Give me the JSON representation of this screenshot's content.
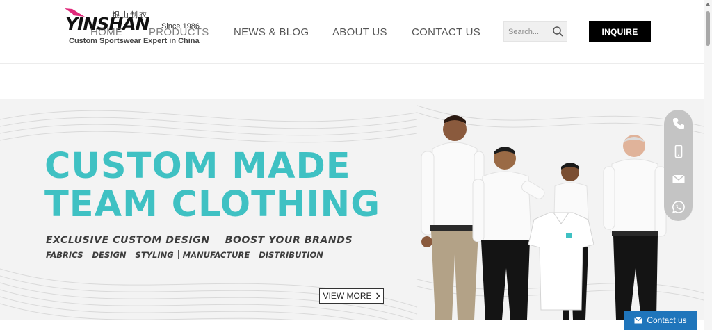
{
  "brand": {
    "name": "YINSHAN",
    "chinese": "银山制衣",
    "since": "Since 1986",
    "tagline": "Custom Sportswear Expert in China",
    "accent_color": "#e0287a"
  },
  "nav": {
    "items": [
      {
        "label": "HOME"
      },
      {
        "label": "PRODUCTS"
      },
      {
        "label": "NEWS & BLOG"
      },
      {
        "label": "ABOUT US"
      },
      {
        "label": "CONTACT US"
      }
    ]
  },
  "search": {
    "placeholder": "Search...",
    "icon": "search-icon"
  },
  "inquire": {
    "label": "INQUIRE"
  },
  "banner": {
    "headline_1": "CUSTOM MADE",
    "headline_2": "TEAM CLOTHING",
    "subline_1": "EXCLUSIVE CUSTOM DESIGN",
    "subline_2": "BOOST YOUR BRANDS",
    "services": [
      "FABRICS",
      "DESIGN",
      "STYLING",
      "MANUFACTURE",
      "DISTRIBUTION"
    ],
    "view_more": "VIEW MORE",
    "headline_color": "#3fc1c3"
  },
  "contact_rail": {
    "icons": [
      "phone-icon",
      "mobile-icon",
      "email-icon",
      "whatsapp-icon"
    ]
  },
  "contact_chat": {
    "label": "Contact us",
    "color": "#1f75bb"
  }
}
